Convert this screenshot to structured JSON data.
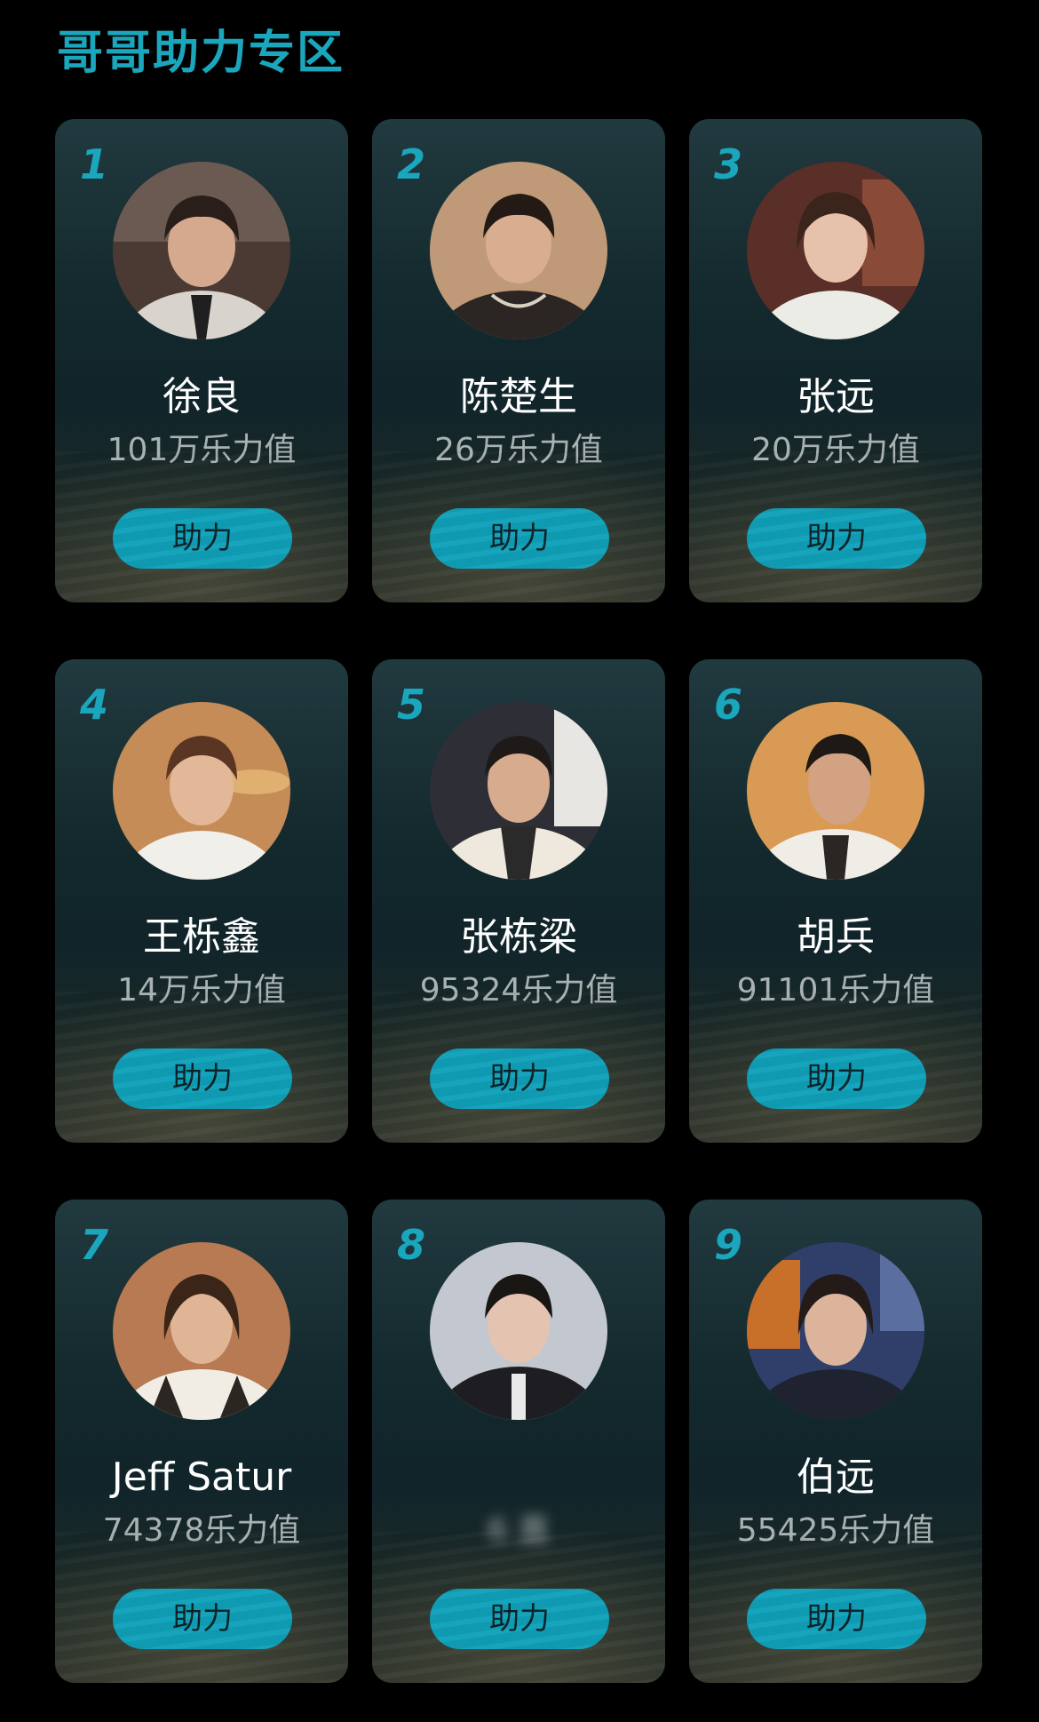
{
  "section": {
    "title": "哥哥助力专区"
  },
  "boost_label": "助力",
  "accent_color": "#1aa7bd",
  "cards": [
    {
      "rank": "1",
      "name": "徐良",
      "score": "101万乐力值"
    },
    {
      "rank": "2",
      "name": "陈楚生",
      "score": "26万乐力值"
    },
    {
      "rank": "3",
      "name": "张远",
      "score": "20万乐力值"
    },
    {
      "rank": "4",
      "name": "王栎鑫",
      "score": "14万乐力值"
    },
    {
      "rank": "5",
      "name": "张栋梁",
      "score": "95324乐力值"
    },
    {
      "rank": "6",
      "name": "胡兵",
      "score": "91101乐力值"
    },
    {
      "rank": "7",
      "name": "Jeff Satur",
      "score": "74378乐力值"
    },
    {
      "rank": "8",
      "name": "",
      "score": "6 直",
      "obscured": true
    },
    {
      "rank": "9",
      "name": "伯远",
      "score": "55425乐力值"
    }
  ]
}
